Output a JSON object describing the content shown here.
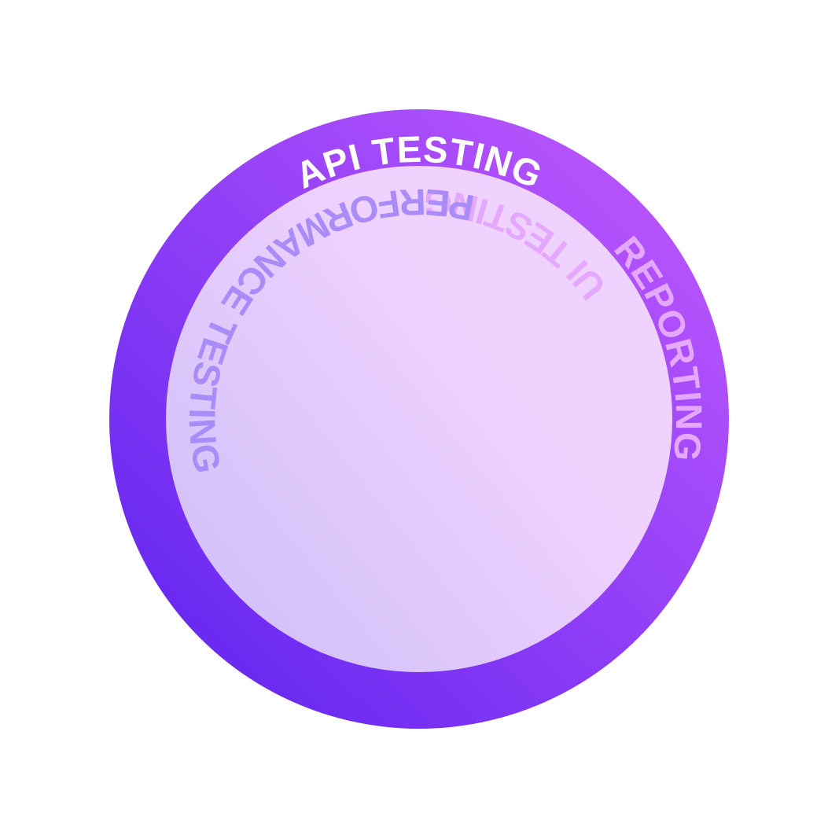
{
  "colors": {
    "ring_start": "#5B21EE",
    "ring_mid": "#8B3CF6",
    "ring_end": "#C45CFF",
    "inner_start": "#CBBDF6",
    "inner_end": "#F0D2FF",
    "active_label": "#FFFFFF",
    "inactive_label_light": "#E4A8FF",
    "inactive_label_dark": "#A98CF8"
  },
  "segments": [
    {
      "label": "API TESTING",
      "active": true
    },
    {
      "label": "REPORTING",
      "active": false
    },
    {
      "label": "UI TESTING",
      "active": false
    },
    {
      "label": "PERFORMANCE TESTING",
      "active": false
    }
  ]
}
